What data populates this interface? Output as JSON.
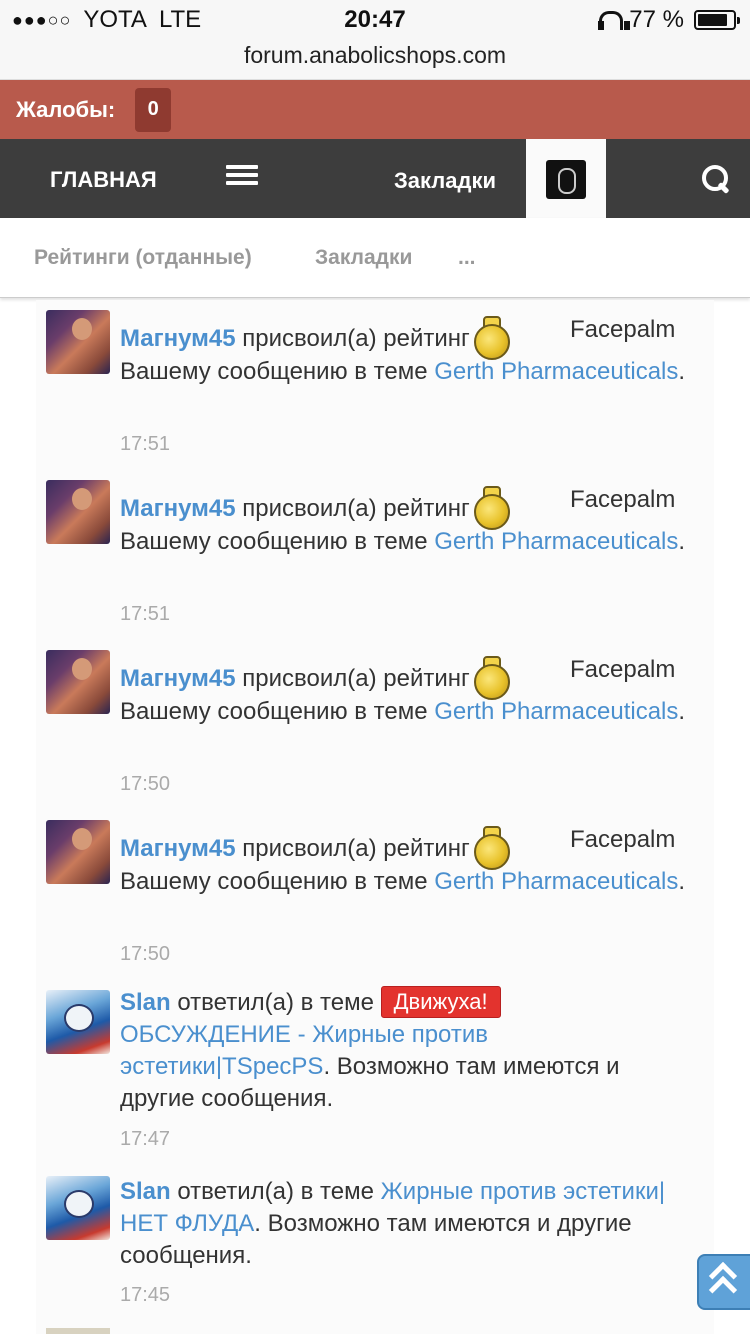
{
  "status_bar": {
    "signal": "●●●○○",
    "carrier": "YOTA",
    "network": "LTE",
    "time": "20:47",
    "battery": "77 %"
  },
  "url": "forum.anabolicshops.com",
  "complaints": {
    "label": "Жалобы:",
    "count": "0"
  },
  "nav": {
    "home": "ГЛАВНАЯ",
    "bookmarks": "Закладки"
  },
  "subtabs": [
    "Рейтинги (отданные)",
    "Закладки",
    "..."
  ],
  "entries": [
    {
      "user": "Магнум45",
      "action": "присвоил(а) рейтинг",
      "rating": "Facepalm",
      "pre": "Вашему сообщению в теме",
      "link": "Gerth Pharmaceuticals",
      "post": ".",
      "time": "17:51"
    },
    {
      "user": "Магнум45",
      "action": "присвоил(а) рейтинг",
      "rating": "Facepalm",
      "pre": "Вашему сообщению в теме",
      "link": "Gerth Pharmaceuticals",
      "post": ".",
      "time": "17:51"
    },
    {
      "user": "Магнум45",
      "action": "присвоил(а) рейтинг",
      "rating": "Facepalm",
      "pre": "Вашему сообщению в теме",
      "link": "Gerth Pharmaceuticals",
      "post": ".",
      "time": "17:50"
    },
    {
      "user": "Магнум45",
      "action": "присвоил(а) рейтинг",
      "rating": "Facepalm",
      "pre": "Вашему сообщению в теме",
      "link": "Gerth Pharmaceuticals",
      "post": ".",
      "time": "17:50"
    },
    {
      "user": "Slan",
      "action": "ответил(а) в теме",
      "badge": "Движуха!",
      "link": "ОБСУЖДЕНИЕ - Жирные против эстетики|TSpecPS",
      "post": ". Возможно там имеются и другие сообщения.",
      "time": "17:47"
    },
    {
      "user": "Slan",
      "action": "ответил(а) в теме",
      "link": "Жирные против эстетики|НЕТ ФЛУДА",
      "post": ". Возможно там имеются и другие сообщения.",
      "time": "17:45"
    }
  ],
  "colors": {
    "complaints_bar": "#b85a4c",
    "nav_bar": "#3d3d3d",
    "link": "#4a8fce",
    "badge": "#e3332e"
  },
  "icons": [
    "headphones-icon",
    "battery-icon",
    "menu-icon",
    "user-avatar",
    "search-icon",
    "medal-icon",
    "scroll-top-icon"
  ]
}
